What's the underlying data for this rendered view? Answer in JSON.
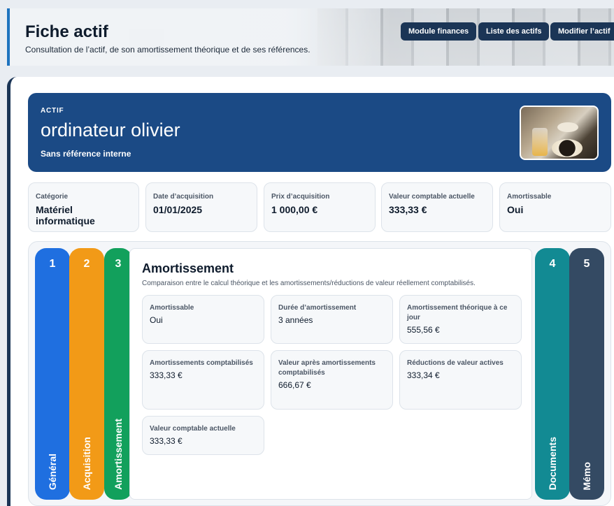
{
  "header": {
    "title": "Fiche actif",
    "subtitle": "Consultation de l’actif, de son amortissement théorique et de ses références.",
    "buttons": [
      "Module finances",
      "Liste des actifs",
      "Modifier l’actif"
    ]
  },
  "hero": {
    "kicker": "ACTIF",
    "name": "ordinateur olivier",
    "reference": "Sans référence interne"
  },
  "stats": [
    {
      "label": "Catégorie",
      "value": "Matériel informatique"
    },
    {
      "label": "Date d’acquisition",
      "value": "01/01/2025"
    },
    {
      "label": "Prix d’acquisition",
      "value": "1 000,00 €"
    },
    {
      "label": "Valeur comptable actuelle",
      "value": "333,33 €"
    },
    {
      "label": "Amortissable",
      "value": "Oui"
    }
  ],
  "tabs": [
    {
      "number": "1",
      "label": "Général",
      "color": "#1f6fe0"
    },
    {
      "number": "2",
      "label": "Acquisition",
      "color": "#f29a17"
    },
    {
      "number": "3",
      "label": "Amortissement",
      "color": "#12a05c"
    },
    {
      "number": "4",
      "label": "Documents",
      "color": "#128a93"
    },
    {
      "number": "5",
      "label": "Mémo",
      "color": "#344a63"
    }
  ],
  "panel": {
    "title": "Amortissement",
    "description": "Comparaison entre le calcul théorique et les amortissements/réductions de valeur réellement comptabilisés.",
    "cells": [
      {
        "label": "Amortissable",
        "value": "Oui"
      },
      {
        "label": "Durée d’amortissement",
        "value": "3 années"
      },
      {
        "label": "Amortissement théorique à ce jour",
        "value": "555,56 €"
      },
      {
        "label": "Amortissements comptabilisés",
        "value": "333,33 €"
      },
      {
        "label": "Valeur après amortissements comptabilisés",
        "value": "666,67 €"
      },
      {
        "label": "Réductions de valeur actives",
        "value": "333,34 €"
      },
      {
        "label": "Valeur comptable actuelle",
        "value": "333,33 €"
      }
    ]
  }
}
